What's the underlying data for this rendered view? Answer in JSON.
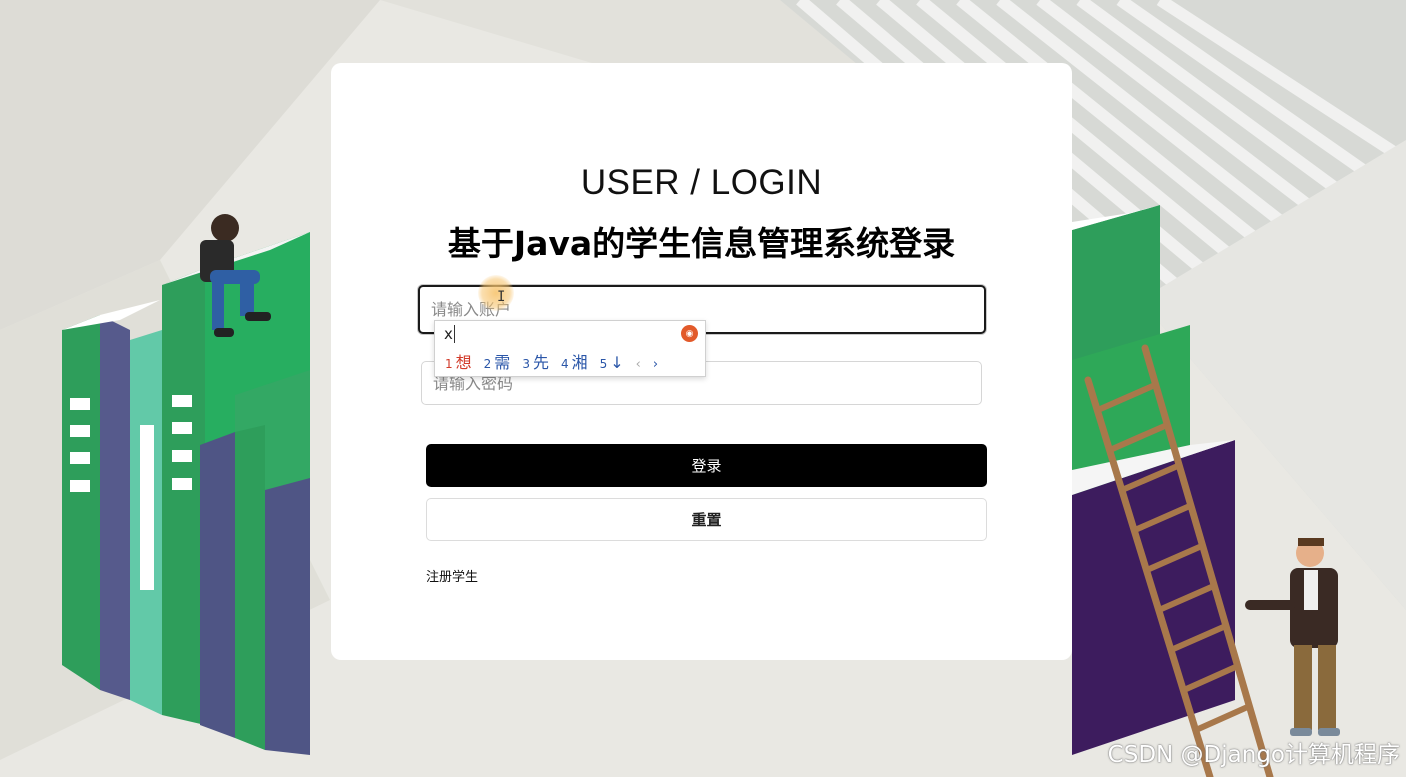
{
  "colors": {
    "accent": "#000000",
    "background": "#e9e8e3",
    "book_green": "#2e9e5b",
    "book_purple": "#4b2a6e"
  },
  "login": {
    "title_en": "USER / LOGIN",
    "title_cn": "基于Java的学生信息管理系统登录",
    "account_placeholder": "请输入账户",
    "account_value": "",
    "password_placeholder": "请输入密码",
    "password_value": "",
    "login_label": "登录",
    "reset_label": "重置",
    "register_label": "注册学生"
  },
  "ime": {
    "composition": "x",
    "candidates": [
      {
        "num": "1",
        "text": "想"
      },
      {
        "num": "2",
        "text": "需"
      },
      {
        "num": "3",
        "text": "先"
      },
      {
        "num": "4",
        "text": "湘"
      },
      {
        "num": "5",
        "text": "↓"
      }
    ],
    "prev_label": "‹",
    "next_label": "›"
  },
  "watermark": "CSDN @Django计算机程序"
}
